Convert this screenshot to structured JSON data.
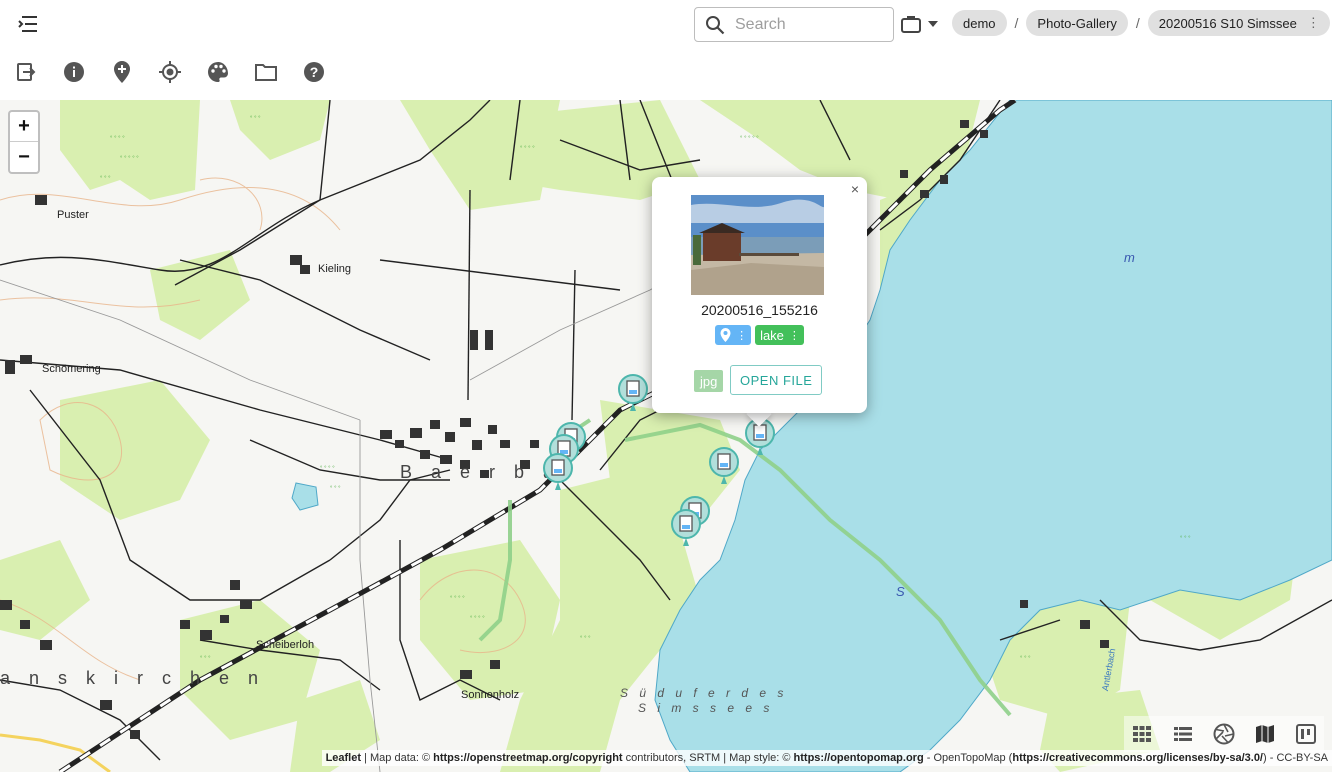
{
  "topbar": {
    "search_placeholder": "Search",
    "breadcrumbs": [
      "demo",
      "Photo-Gallery",
      "20200516 S10 Simssee"
    ],
    "separator": "/"
  },
  "toolbar": {
    "icons": [
      "exit-icon",
      "info-icon",
      "add-location-icon",
      "my-location-icon",
      "palette-icon",
      "folder-icon",
      "help-icon"
    ]
  },
  "map": {
    "zoom_in": "+",
    "zoom_out": "−",
    "labels": {
      "puster": "Puster",
      "kieling": "Kieling",
      "schomering": "Schömering",
      "scheiberloh": "Scheiberloh",
      "sonnenholz": "Sonnenholz",
      "town_bernau": "B a   e r  b a",
      "town_prien": "a n s k i r c h e n",
      "lake_shore_1": "S ü d u f e r  d e s",
      "lake_shore_2": "S i m s s e e s",
      "stream": "Antlerbach",
      "lake_s": "S",
      "lake_m": "m"
    }
  },
  "popup": {
    "close": "×",
    "title": "20200516_155216",
    "tag_lake": "lake",
    "tag_more": "⋮",
    "extension": "jpg",
    "open_button": "OPEN FILE"
  },
  "attribution": {
    "leaflet": "Leaflet",
    "text1": " | Map data: © ",
    "osm": "https://openstreetmap.org/copyright",
    "text2": " contributors, SRTM | Map style: © ",
    "otm": "https://opentopomap.org",
    "text3": " - OpenTopoMap (",
    "cc": "https://creativecommons.org/licenses/by-sa/3.0/",
    "text4": ") - CC-BY-SA"
  },
  "viewbar": {
    "icons": [
      "grid-view-icon",
      "list-view-icon",
      "camera-aperture-icon",
      "map-view-icon",
      "board-view-icon"
    ]
  },
  "colors": {
    "water": "#a9dfe8",
    "forest": "#d9efb0",
    "track": "#8fd08a",
    "accent": "#26a69a"
  }
}
